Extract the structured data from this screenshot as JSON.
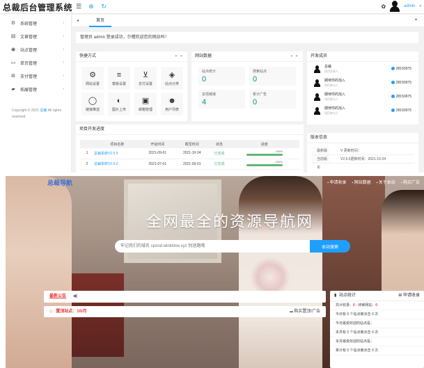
{
  "admin": {
    "logo": "总裁后台管理系统",
    "user": "admin",
    "sidebar": {
      "items": [
        {
          "label": "系统管理",
          "icon": "gear-icon",
          "glyph": "⚙"
        },
        {
          "label": "文章管理",
          "icon": "document-icon",
          "glyph": "▤"
        },
        {
          "label": "站点管理",
          "icon": "compass-icon",
          "glyph": "◉"
        },
        {
          "label": "单页管理",
          "icon": "page-icon",
          "glyph": "▭"
        },
        {
          "label": "支付管理",
          "icon": "cart-icon",
          "glyph": "⊞"
        },
        {
          "label": "拓展管理",
          "icon": "puzzle-icon",
          "glyph": "▰"
        }
      ],
      "copyright_pre": "Copyright © 2021",
      "copyright_link": "总裁",
      "copyright_post": "All rights reserved"
    },
    "tabs": {
      "home": "首页"
    },
    "notice": "管理员 admin 登录成功，尔稽欢迎您的网站吗！",
    "quick": {
      "title": "快捷方式",
      "items": [
        {
          "label": "网站设置",
          "glyph": "⚙"
        },
        {
          "label": "模板设置",
          "glyph": "≡"
        },
        {
          "label": "支付设置",
          "glyph": "⊻"
        },
        {
          "label": "站点分类",
          "glyph": "◈"
        },
        {
          "label": "链接推送",
          "glyph": "◯"
        },
        {
          "label": "图片上传",
          "glyph": "◐"
        },
        {
          "label": "邮箱管理",
          "glyph": "▣"
        },
        {
          "label": "用户列表",
          "glyph": "☻"
        }
      ]
    },
    "site_data": {
      "title": "网站数据",
      "boxes": [
        {
          "label": "站点统计",
          "value": "0"
        },
        {
          "label": "搜索站点",
          "value": "0"
        },
        {
          "label": "友情链接",
          "value": "4"
        },
        {
          "label": "累计广告",
          "value": "0"
        }
      ]
    },
    "devs": {
      "title": "开发成员",
      "members": [
        {
          "name": "总裁",
          "role": "项目负责人",
          "qq": "28150975"
        },
        {
          "name": "期待你的加入",
          "role": "项目参与人",
          "qq": "28150975"
        },
        {
          "name": "期待你的加入",
          "role": "项目参与人",
          "qq": "28150975"
        },
        {
          "name": "期待你的加入",
          "role": "项目参与人",
          "qq": "28150975"
        }
      ]
    },
    "progress": {
      "title": "项目开发进度",
      "headers": [
        "项目名称",
        "开始时间",
        "截至时间",
        "状态",
        "进度"
      ],
      "rows": [
        {
          "no": "1",
          "name": "总裁系统V2.5.5",
          "start": "2021-09-01",
          "end": "2021-10-24",
          "status": "已完成",
          "pct": "100%",
          "fraction": 1.0
        },
        {
          "no": "2",
          "name": "总裁系统V2.5.0",
          "start": "2021-07-01",
          "end": "2021-09-01",
          "status": "已完成",
          "pct": "100%",
          "fraction": 1.0
        }
      ]
    },
    "version": {
      "title": "版本信息",
      "rows": [
        {
          "k": "最新版本",
          "v": "V 更新时间："
        },
        {
          "k": "当前版本",
          "v": "V2.5.5更新时间：2021-10-24"
        }
      ]
    }
  },
  "site": {
    "logo": "总裁导航",
    "nav": [
      "申请收录",
      "网站数据",
      "关于本站",
      "购买广告"
    ],
    "hero_title": "全网最全的资源导航网",
    "search": {
      "placeholder": "牢记我们的域名 spond.winktime.xyz 别迷路哦",
      "button": "本站搜索"
    },
    "notice_title": "最新公告",
    "top_label": "置顶站点：10/月",
    "buy_label": "购买置顶/广告",
    "stats": {
      "title": "站点统计",
      "apply": "申请收录",
      "rows": [
        {
          "a": "共计收录：",
          "av": "0",
          "b": " - 待审网站：",
          "bv": "0"
        },
        {
          "text": "今日有 0 个站点被点击 0 次"
        },
        {
          "text": "今日最受欢迎的站点是："
        },
        {
          "text": "本月有 0 个站点被点击 0 次"
        },
        {
          "text": "本月最受欢迎的站点是："
        },
        {
          "text": "累计有 0 个站点被点击 0 次"
        }
      ]
    }
  }
}
